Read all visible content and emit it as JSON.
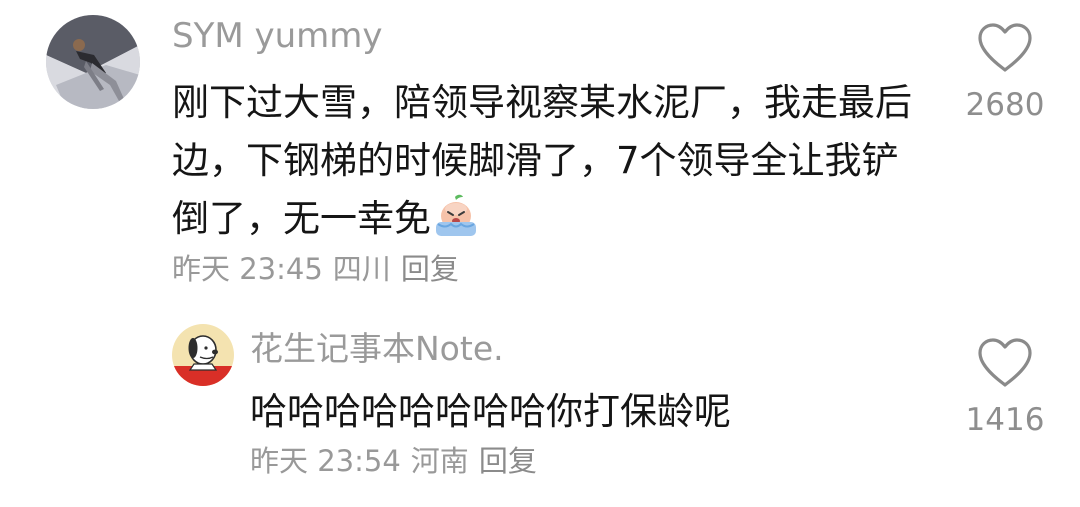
{
  "comments": [
    {
      "username": "SYM yummy",
      "text": "刚下过大雪，陪领导视察某水泥厂，我走最后边，下钢梯的时候脚滑了，7个领导全让我铲倒了，无一幸免",
      "emoji": "crying-emoji",
      "time": "昨天 23:45",
      "location": "四川",
      "reply_label": "回复",
      "likes": "2680",
      "like_icon": "heart-outline-icon"
    },
    {
      "username": "花生记事本Note.",
      "text": "哈哈哈哈哈哈哈哈你打保龄呢",
      "time": "昨天 23:54",
      "location": "河南",
      "reply_label": "回复",
      "likes": "1416",
      "like_icon": "heart-outline-icon"
    }
  ],
  "colors": {
    "text": "#151515",
    "muted": "#999999",
    "heart": "#8a8a8a",
    "background": "#ffffff"
  }
}
